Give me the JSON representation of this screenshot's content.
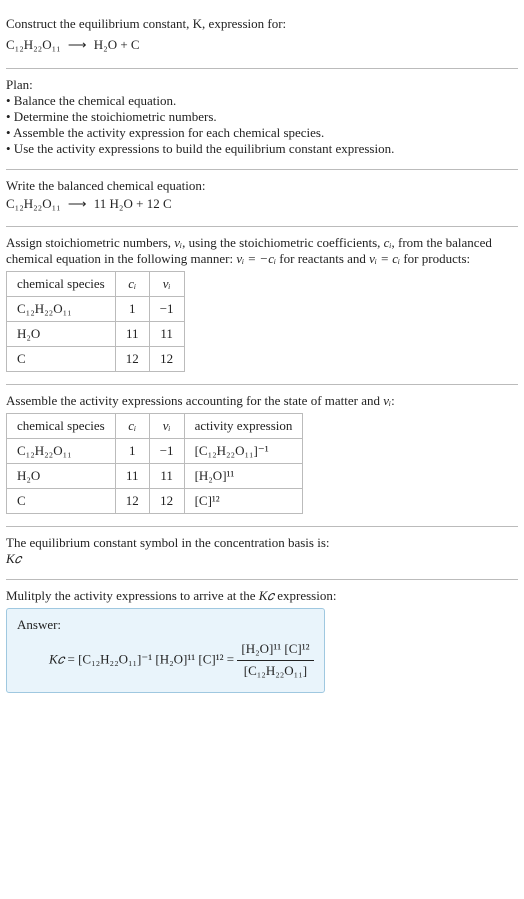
{
  "intro": {
    "line1": "Construct the equilibrium constant, K, expression for:",
    "eq_lhs": "C₁₂H₂₂O₁₁",
    "eq_arrow": "⟶",
    "eq_rhs": "H₂O + C"
  },
  "plan": {
    "heading": "Plan:",
    "items": [
      "• Balance the chemical equation.",
      "• Determine the stoichiometric numbers.",
      "• Assemble the activity expression for each chemical species.",
      "• Use the activity expressions to build the equilibrium constant expression."
    ]
  },
  "balanced": {
    "heading": "Write the balanced chemical equation:",
    "eq_lhs": "C₁₂H₂₂O₁₁",
    "eq_arrow": "⟶",
    "eq_rhs": "11 H₂O + 12 C"
  },
  "stoich": {
    "text_a": "Assign stoichiometric numbers, ",
    "nu": "νᵢ",
    "text_b": ", using the stoichiometric coefficients, ",
    "ci": "cᵢ",
    "text_c": ", from the balanced chemical equation in the following manner: ",
    "rel1": "νᵢ = −cᵢ",
    "text_d": " for reactants and ",
    "rel2": "νᵢ = cᵢ",
    "text_e": " for products:",
    "headers": {
      "species": "chemical species",
      "ci": "cᵢ",
      "nu": "νᵢ"
    },
    "rows": [
      {
        "species": "C₁₂H₂₂O₁₁",
        "ci": "1",
        "nu": "−1"
      },
      {
        "species": "H₂O",
        "ci": "11",
        "nu": "11"
      },
      {
        "species": "C",
        "ci": "12",
        "nu": "12"
      }
    ]
  },
  "activity": {
    "heading_a": "Assemble the activity expressions accounting for the state of matter and ",
    "nu": "νᵢ",
    "heading_b": ":",
    "headers": {
      "species": "chemical species",
      "ci": "cᵢ",
      "nu": "νᵢ",
      "act": "activity expression"
    },
    "rows": [
      {
        "species": "C₁₂H₂₂O₁₁",
        "ci": "1",
        "nu": "−1",
        "act": "[C₁₂H₂₂O₁₁]⁻¹"
      },
      {
        "species": "H₂O",
        "ci": "11",
        "nu": "11",
        "act": "[H₂O]¹¹"
      },
      {
        "species": "C",
        "ci": "12",
        "nu": "12",
        "act": "[C]¹²"
      }
    ]
  },
  "symbol": {
    "text": "The equilibrium constant symbol in the concentration basis is:",
    "kc": "K𝑐"
  },
  "multiply": {
    "text_a": "Mulitply the activity expressions to arrive at the ",
    "kc": "K𝑐",
    "text_b": " expression:"
  },
  "answer": {
    "label": "Answer:",
    "kc": "K𝑐",
    "lhs": " = [C₁₂H₂₂O₁₁]⁻¹ [H₂O]¹¹ [C]¹² = ",
    "num": "[H₂O]¹¹ [C]¹²",
    "den": "[C₁₂H₂₂O₁₁]"
  }
}
